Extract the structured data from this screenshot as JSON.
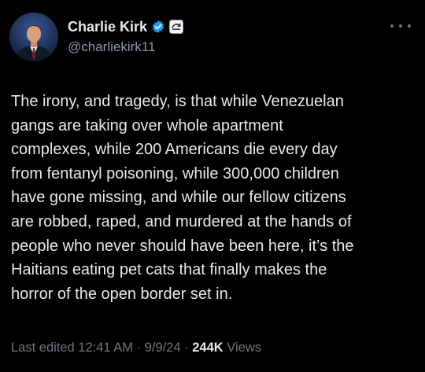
{
  "author": {
    "display_name": "Charlie Kirk",
    "handle": "@charliekirk11",
    "verified_icon": "verified-badge-icon",
    "affiliation_icon": "affiliation-badge-icon"
  },
  "tweet": {
    "lines": [
      "The irony, and tragedy, is that while Venezuelan",
      "gangs are taking over whole apartment",
      "complexes, while 200 Americans die every day",
      "from fentanyl poisoning, while 300,000 children",
      "have gone missing, and while our fellow citizens",
      "are robbed, raped, and murdered at the hands of",
      "people who never should have been here, it’s the",
      "Haitians eating pet cats that finally makes the",
      "horror of the open border set in."
    ]
  },
  "meta": {
    "edited_label": "Last edited 12:41 AM",
    "sep1": " · ",
    "date": "9/9/24",
    "sep2": " · ",
    "views_count": "244K",
    "views_label": " Views"
  },
  "colors": {
    "background": "#000000",
    "text": "#e7e9ea",
    "secondary": "#71767b",
    "verified": "#1d9bf0"
  }
}
